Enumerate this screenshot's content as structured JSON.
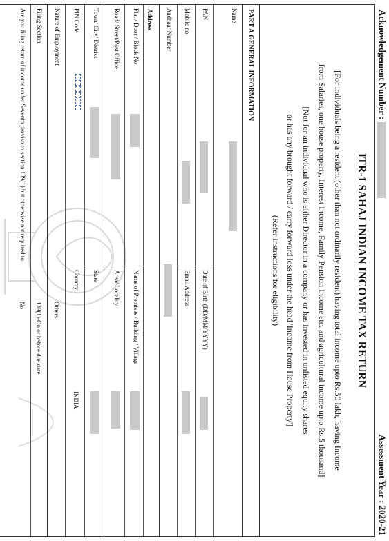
{
  "header": {
    "ack_label": "Acknowledgement Number :",
    "assessment_year": "Assessment Year : 2020-21"
  },
  "form": {
    "title": "ITR-1 SAHAJ INDIAN INCOME TAX RETURN",
    "line1": "[For individuals being a resident (other than not ordinarily resident) having total income upto Rs.50 lakh, having Income",
    "line2": "from Salaries, one house property, Interest Income, Family Pension Income etc. and agricultural income upto Rs.5 thousand]",
    "line3": "[Not for an individual who is either Director in a company or has invested in unlisted equity shares",
    "line4": "or has any brought forward / carry forward loss under the head 'Income from House Property']",
    "refer": "(Refer instructions for eligibility)"
  },
  "part_a": {
    "title": "PART A GENERAL INFORMATION",
    "name_label": "Name",
    "pan_label": "PAN",
    "dob_label": "Date of Birth (DD/MM/YYYY)",
    "mobile_label": "Mobile no",
    "email_label": "Email Address",
    "aadhaar_label": "Aadhaar Number",
    "address_heading": "Address",
    "flat_label": "Flat / Door / Block No",
    "premises_label": "Name of Premises / Building / Village",
    "road_label": "Road/ Street/Post Office",
    "area_label": "Area/ Locality",
    "town_label": "Town/ City/ District",
    "state_label": "State",
    "pin_label": "PIN Code",
    "country_label": "Country",
    "country_value": "INDIA",
    "employment_label": "Nature of Employment",
    "employment_value": "Others",
    "filing_label": "Filing Section",
    "filing_value": "139(1)-On or before due date",
    "seventh_proviso_label": "Are you filing return of income under Seventh proviso to section 139(1) but otherwise not required to",
    "seventh_proviso_value": "No"
  }
}
